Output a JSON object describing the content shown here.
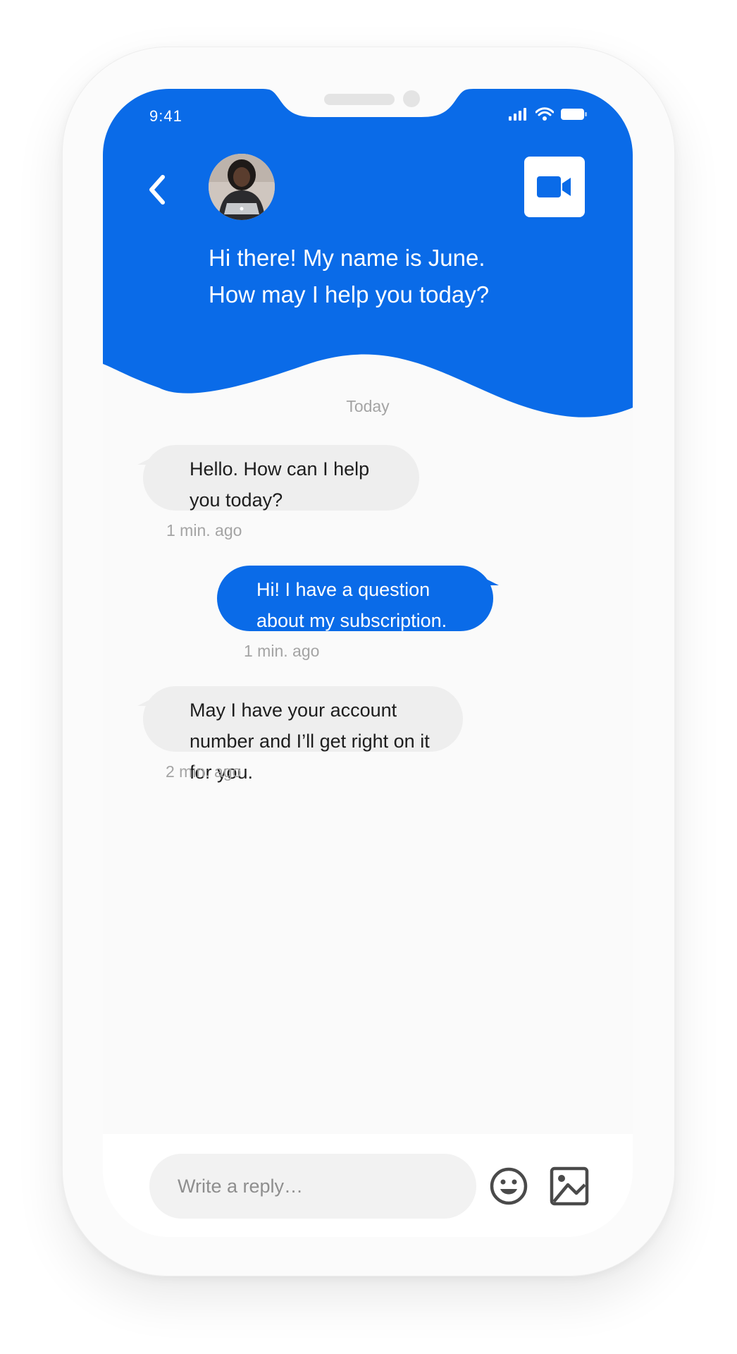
{
  "status_bar": {
    "time": "9:41"
  },
  "header": {
    "greeting": "Hi there! My name is June.\nHow may I help you today?",
    "accent_color": "#0a6be8"
  },
  "chat": {
    "day_label": "Today",
    "messages": [
      {
        "sender": "agent",
        "text": "Hello. How can I help you today?",
        "time": "1 min. ago"
      },
      {
        "sender": "user",
        "text": "Hi! I have a question about my subscription.",
        "time": "1 min. ago"
      },
      {
        "sender": "agent",
        "text": "May I have your account number and I’ll get right on it for you.",
        "time": "2 min. ago"
      }
    ]
  },
  "composer": {
    "placeholder": "Write a reply…"
  },
  "icons": {
    "back": "chevron-left-icon",
    "video": "video-camera-icon",
    "emoji": "smiley-face-icon",
    "image": "image-icon",
    "signal": "cellular-signal-icon",
    "wifi": "wifi-icon",
    "battery": "battery-icon"
  }
}
